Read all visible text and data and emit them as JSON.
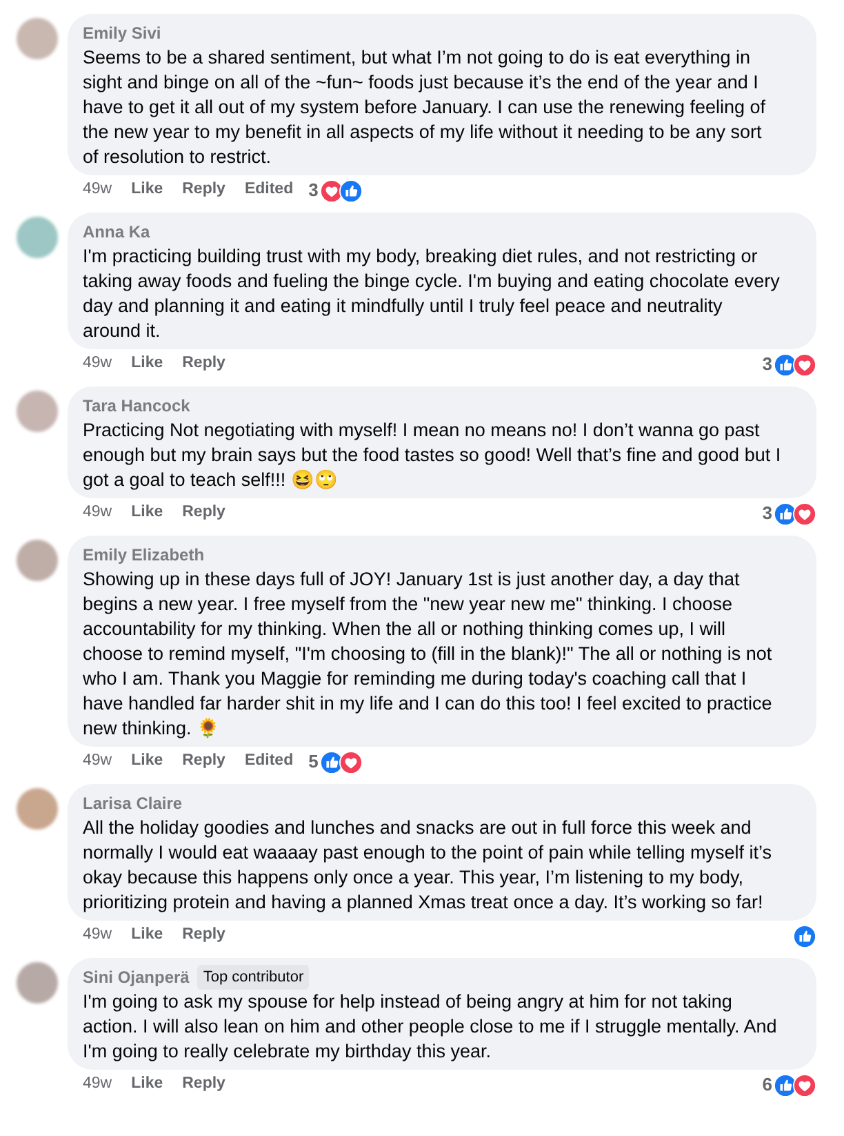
{
  "comments": [
    {
      "author": "Emily Sivi",
      "text": "Seems to be a shared sentiment, but what I’m not going to do is eat everything in sight and binge on all of the ~fun~ foods just because it’s the end of the year and I have to get it all out of my system before January. I can use the renewing feeling of the new year to my benefit in all aspects of my life without it needing to be any sort of resolution to restrict.",
      "time": "49w",
      "actions": [
        "Like",
        "Reply"
      ],
      "edited": "Edited",
      "reactions": {
        "count": "3",
        "icons": [
          {
            "kind": "love"
          },
          {
            "kind": "like"
          }
        ]
      }
    },
    {
      "author": "Anna Ka",
      "text": "I'm practicing building trust with my body, breaking diet rules, and not restricting or taking away foods and fueling the binge cycle. I'm buying and eating chocolate every day and planning it and eating it mindfully until I truly feel peace and neutrality around it.",
      "time": "49w",
      "actions": [
        "Like",
        "Reply"
      ],
      "reactions": {
        "count": "3",
        "icons": [
          {
            "kind": "like"
          },
          {
            "kind": "love"
          }
        ]
      }
    },
    {
      "author": "Tara Hancock",
      "text": "Practicing Not negotiating with myself! I mean no means no! I don’t wanna go past enough but my brain says but the food tastes so good! Well that’s fine and good but I got a goal to teach self!!! 😆🙄",
      "time": "49w",
      "actions": [
        "Like",
        "Reply"
      ],
      "reactions": {
        "count": "3",
        "icons": [
          {
            "kind": "like"
          },
          {
            "kind": "love"
          }
        ]
      }
    },
    {
      "author": "Emily Elizabeth",
      "text": "Showing up in these days full of JOY! January 1st is just another day, a day that begins a new year. I free myself from the \"new year new me\" thinking. I choose accountability for my thinking. When the all or nothing thinking comes up, I will choose to remind myself, \"I'm choosing to (fill in the blank)!\" The all or nothing is not who I am. Thank you Maggie for reminding me during today's coaching call that I have handled far harder shit in my life and I can do this too! I feel excited to practice new thinking. 🌻",
      "time": "49w",
      "actions": [
        "Like",
        "Reply"
      ],
      "edited": "Edited",
      "reactions": {
        "count": "5",
        "icons": [
          {
            "kind": "like"
          },
          {
            "kind": "love"
          }
        ]
      }
    },
    {
      "author": "Larisa Claire",
      "text": "All the holiday goodies and lunches and snacks are out in full force this week and normally I would eat waaaay past enough to the point of pain while telling myself it’s okay because this happens only once a year. This year, I’m listening to my body, prioritizing protein and having a planned Xmas treat once a day. It’s working so far!",
      "time": "49w",
      "actions": [
        "Like",
        "Reply"
      ],
      "reactions": {
        "icons": [
          {
            "kind": "like"
          }
        ]
      }
    },
    {
      "author": "Sini Ojanperä",
      "badge": "Top contributor",
      "text": "I'm going to ask my spouse for help instead of being angry at him for not taking action. I will also lean on him and other people close to me if I struggle mentally. And I'm going to really celebrate my birthday this year.",
      "time": "49w",
      "actions": [
        "Like",
        "Reply"
      ],
      "reactions": {
        "count": "6",
        "icons": [
          {
            "kind": "like"
          },
          {
            "kind": "love"
          }
        ]
      }
    }
  ]
}
